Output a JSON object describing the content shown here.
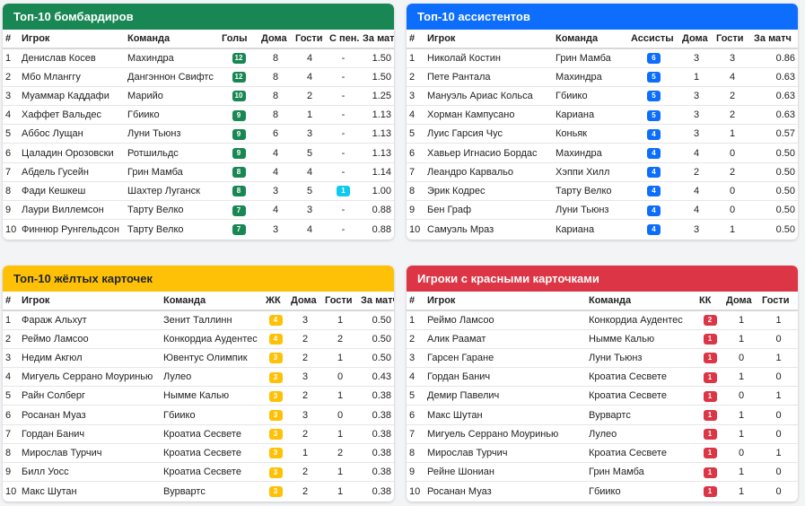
{
  "colors": {
    "green": "#198754",
    "blue": "#0d6efd",
    "yellow": "#ffc107",
    "red": "#dc3545",
    "cyan": "#0dcaf0"
  },
  "scorers": {
    "title": "Топ-10 бомбардиров",
    "headers": [
      "#",
      "Игрок",
      "Команда",
      "Голы",
      "Дома",
      "Гости",
      "С пен.",
      "За матч"
    ],
    "rows": [
      [
        "1",
        "Денислав Косев",
        "Махиндра",
        "12",
        "8",
        "4",
        "-",
        "1.50"
      ],
      [
        "2",
        "Мбо Мланггу",
        "Дангэннон Свифтс",
        "12",
        "8",
        "4",
        "-",
        "1.50"
      ],
      [
        "3",
        "Муаммар Каддафи",
        "Марийо",
        "10",
        "8",
        "2",
        "-",
        "1.25"
      ],
      [
        "4",
        "Хаффет Вальдес",
        "Гбиико",
        "9",
        "8",
        "1",
        "-",
        "1.13"
      ],
      [
        "5",
        "Аббос Лущан",
        "Луни Тьюнз",
        "9",
        "6",
        "3",
        "-",
        "1.13"
      ],
      [
        "6",
        "Цаладин Орозовски",
        "Ротшильдс",
        "9",
        "4",
        "5",
        "-",
        "1.13"
      ],
      [
        "7",
        "Абдель Гусейн",
        "Грин Мамба",
        "8",
        "4",
        "4",
        "-",
        "1.14"
      ],
      [
        "8",
        "Фади Кешкеш",
        "Шахтер Луганск",
        "8",
        "3",
        "5",
        "1",
        "1.00"
      ],
      [
        "9",
        "Лаури Виллемсон",
        "Тарту Велко",
        "7",
        "4",
        "3",
        "-",
        "0.88"
      ],
      [
        "10",
        "Финнюр Рунгельдсон",
        "Тарту Велко",
        "7",
        "3",
        "4",
        "-",
        "0.88"
      ]
    ]
  },
  "assists": {
    "title": "Топ-10 ассистентов",
    "headers": [
      "#",
      "Игрок",
      "Команда",
      "Ассисты",
      "Дома",
      "Гости",
      "За матч"
    ],
    "rows": [
      [
        "1",
        "Николай Костин",
        "Грин Мамба",
        "6",
        "3",
        "3",
        "0.86"
      ],
      [
        "2",
        "Пете Рантала",
        "Махиндра",
        "5",
        "1",
        "4",
        "0.63"
      ],
      [
        "3",
        "Мануэль Ариас Кольса",
        "Гбиико",
        "5",
        "3",
        "2",
        "0.63"
      ],
      [
        "4",
        "Хорман Кампусано",
        "Кариана",
        "5",
        "3",
        "2",
        "0.63"
      ],
      [
        "5",
        "Луис Гарсия Чус",
        "Коньяк",
        "4",
        "3",
        "1",
        "0.57"
      ],
      [
        "6",
        "Хавьер Игнасио Бордас",
        "Махиндра",
        "4",
        "4",
        "0",
        "0.50"
      ],
      [
        "7",
        "Леандро Карвальо",
        "Хэппи Хилл",
        "4",
        "2",
        "2",
        "0.50"
      ],
      [
        "8",
        "Эрик Кодрес",
        "Тарту Велко",
        "4",
        "4",
        "0",
        "0.50"
      ],
      [
        "9",
        "Бен Граф",
        "Луни Тьюнз",
        "4",
        "4",
        "0",
        "0.50"
      ],
      [
        "10",
        "Самуэль Мраз",
        "Кариана",
        "4",
        "3",
        "1",
        "0.50"
      ]
    ]
  },
  "yellow": {
    "title": "Топ-10 жёлтых карточек",
    "headers": [
      "#",
      "Игрок",
      "Команда",
      "ЖК",
      "Дома",
      "Гости",
      "За матч"
    ],
    "rows": [
      [
        "1",
        "Фараж Альхут",
        "Зенит Таллинн",
        "4",
        "3",
        "1",
        "0.50"
      ],
      [
        "2",
        "Реймо Ламсоо",
        "Конкордиа Аудентес",
        "4",
        "2",
        "2",
        "0.50"
      ],
      [
        "3",
        "Недим Акгюл",
        "Ювентус Олимпик",
        "3",
        "2",
        "1",
        "0.50"
      ],
      [
        "4",
        "Мигуель Серрано Моуринью",
        "Лулео",
        "3",
        "3",
        "0",
        "0.43"
      ],
      [
        "5",
        "Райн Солберг",
        "Нымме Калью",
        "3",
        "2",
        "1",
        "0.38"
      ],
      [
        "6",
        "Росанан Муаз",
        "Гбиико",
        "3",
        "3",
        "0",
        "0.38"
      ],
      [
        "7",
        "Гордан Банич",
        "Кроатиа Сесвете",
        "3",
        "2",
        "1",
        "0.38"
      ],
      [
        "8",
        "Мирослав Турчич",
        "Кроатиа Сесвете",
        "3",
        "1",
        "2",
        "0.38"
      ],
      [
        "9",
        "Билл Уосс",
        "Кроатиа Сесвете",
        "3",
        "2",
        "1",
        "0.38"
      ],
      [
        "10",
        "Макс Шутан",
        "Вурвартс",
        "3",
        "2",
        "1",
        "0.38"
      ]
    ]
  },
  "red": {
    "title": "Игроки с красными карточками",
    "headers": [
      "#",
      "Игрок",
      "Команда",
      "КК",
      "Дома",
      "Гости"
    ],
    "rows": [
      [
        "1",
        "Реймо Ламсоо",
        "Конкордиа Аудентес",
        "2",
        "1",
        "1"
      ],
      [
        "2",
        "Алик Раамат",
        "Нымме Калью",
        "1",
        "1",
        "0"
      ],
      [
        "3",
        "Гарсен Гаране",
        "Луни Тьюнз",
        "1",
        "0",
        "1"
      ],
      [
        "4",
        "Гордан Банич",
        "Кроатиа Сесвете",
        "1",
        "1",
        "0"
      ],
      [
        "5",
        "Демир Павелич",
        "Кроатиа Сесвете",
        "1",
        "0",
        "1"
      ],
      [
        "6",
        "Макс Шутан",
        "Вурвартс",
        "1",
        "1",
        "0"
      ],
      [
        "7",
        "Мигуель Серрано Моуринью",
        "Лулео",
        "1",
        "1",
        "0"
      ],
      [
        "8",
        "Мирослав Турчич",
        "Кроатиа Сесвете",
        "1",
        "0",
        "1"
      ],
      [
        "9",
        "Рейне Шониан",
        "Грин Мамба",
        "1",
        "1",
        "0"
      ],
      [
        "10",
        "Росанан Муаз",
        "Гбиико",
        "1",
        "1",
        "0"
      ]
    ]
  }
}
